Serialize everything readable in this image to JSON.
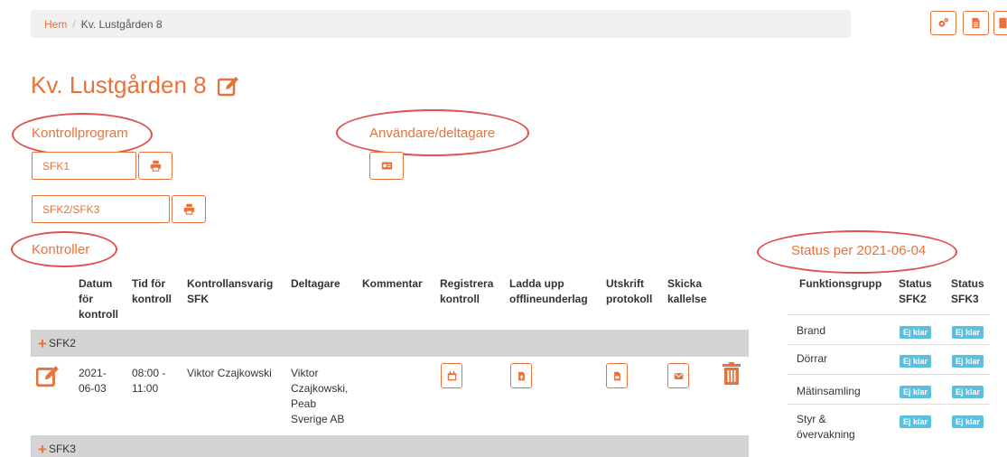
{
  "breadcrumb": {
    "home": "Hem",
    "separator": "/",
    "current": "Kv. Lustgården 8"
  },
  "top_buttons": [
    {
      "icon": "cogs-icon"
    },
    {
      "icon": "document-icon"
    },
    {
      "icon": "bookmark-icon"
    }
  ],
  "page_title": "Kv. Lustgården 8",
  "sections": {
    "kontrollprogram": "Kontrollprogram",
    "anvandare": "Användare/deltagare",
    "kontroller": "Kontroller",
    "status": "Status per 2021-06-04"
  },
  "programs": [
    {
      "label": "SFK1"
    },
    {
      "label": "SFK2/SFK3"
    }
  ],
  "table": {
    "headers": {
      "datum": "Datum för kontroll",
      "tid": "Tid för kontroll",
      "ansvarig": "Kontrollansvarig SFK",
      "deltagare": "Deltagare",
      "kommentar": "Kommentar",
      "registrera": "Registrera kontroll",
      "ladda": "Ladda upp offlineunderlag",
      "utskrift": "Utskrift protokoll",
      "skicka": "Skicka kallelse"
    },
    "groups": [
      {
        "label": "SFK2",
        "rows": [
          {
            "datum": "2021-06-03",
            "tid": "08:00 - 11:00",
            "ansvarig": "Viktor Czajkowski",
            "deltagare": "Viktor Czajkowski, Peab Sverige AB",
            "kommentar": ""
          }
        ]
      },
      {
        "label": "SFK3",
        "rows": []
      }
    ]
  },
  "status_table": {
    "headers": {
      "grupp": "Funktionsgrupp",
      "sfk2": "Status SFK2",
      "sfk3": "Status SFK3"
    },
    "rows": [
      {
        "grupp": "Brand",
        "sfk2": "Ej klar",
        "sfk3": "Ej klar"
      },
      {
        "grupp": "Dörrar",
        "sfk2": "Ej klar",
        "sfk3": "Ej klar"
      },
      {
        "grupp": "Mätinsamling",
        "sfk2": "Ej klar",
        "sfk3": "Ej klar"
      },
      {
        "grupp": "Styr & övervakning",
        "sfk2": "Ej klar",
        "sfk3": "Ej klar"
      }
    ]
  },
  "colors": {
    "accent": "#e8733a",
    "badge": "#5bc0de",
    "annotation": "#e05050",
    "group_row": "#d4d4d4"
  }
}
